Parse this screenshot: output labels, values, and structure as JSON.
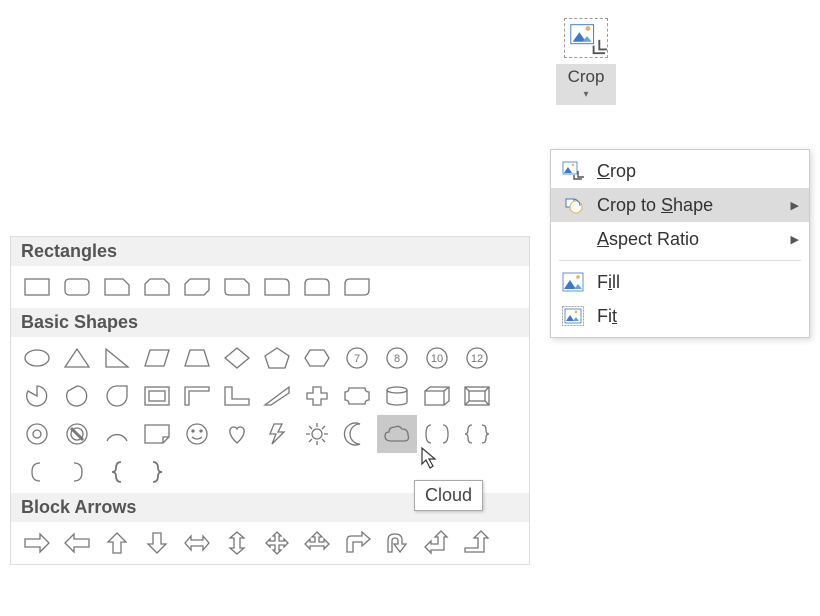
{
  "crop_button": {
    "label": "Crop"
  },
  "menu": {
    "items": [
      {
        "id": "crop",
        "label_html": "<u>C</u>rop",
        "icon": "crop-icon",
        "submenu": false
      },
      {
        "id": "crop_to_shape",
        "label_html": "Crop to <u>S</u>hape",
        "icon": "crop-shape-icon",
        "submenu": true,
        "hovered": true
      },
      {
        "id": "aspect_ratio",
        "label_html": "<u>A</u>spect Ratio",
        "icon": "",
        "submenu": true
      },
      {
        "sep": true
      },
      {
        "id": "fill",
        "label_html": "F<u>i</u>ll",
        "icon": "fill-icon",
        "submenu": false
      },
      {
        "id": "fit",
        "label_html": "Fi<u>t</u>",
        "icon": "fit-icon",
        "submenu": false
      }
    ]
  },
  "shapes": {
    "sections": [
      {
        "title": "Rectangles",
        "items": [
          "rectangle",
          "rounded-rectangle",
          "snip-single-corner",
          "snip-same-side",
          "snip-diagonal",
          "snip-round-single",
          "round-single-corner",
          "round-same-side",
          "round-diagonal"
        ]
      },
      {
        "title": "Basic Shapes",
        "items": [
          "oval",
          "triangle",
          "right-triangle",
          "parallelogram",
          "trapezoid",
          "diamond",
          "pentagon",
          "hexagon",
          "heptagon",
          "octagon",
          "decagon",
          "dodecagon",
          "pie",
          "chord",
          "teardrop",
          "frame",
          "half-frame",
          "l-shape",
          "diagonal-stripe",
          "cross",
          "plaque",
          "can",
          "cube",
          "bevel",
          "donut",
          "no-symbol",
          "arc",
          "folded-corner",
          "smiley",
          "heart",
          "lightning",
          "sun",
          "moon",
          "cloud",
          "double-bracket",
          "double-brace",
          "left-bracket",
          "right-bracket",
          "left-brace",
          "right-brace"
        ]
      },
      {
        "title": "Block Arrows",
        "items": [
          "right-arrow",
          "left-arrow",
          "up-arrow",
          "down-arrow",
          "left-right-arrow",
          "up-down-arrow",
          "quad-arrow",
          "left-right-up",
          "bent-right",
          "u-turn",
          "left-up",
          "bent-up"
        ]
      }
    ]
  },
  "tooltip": "Cloud",
  "hovered_shape": "cloud"
}
